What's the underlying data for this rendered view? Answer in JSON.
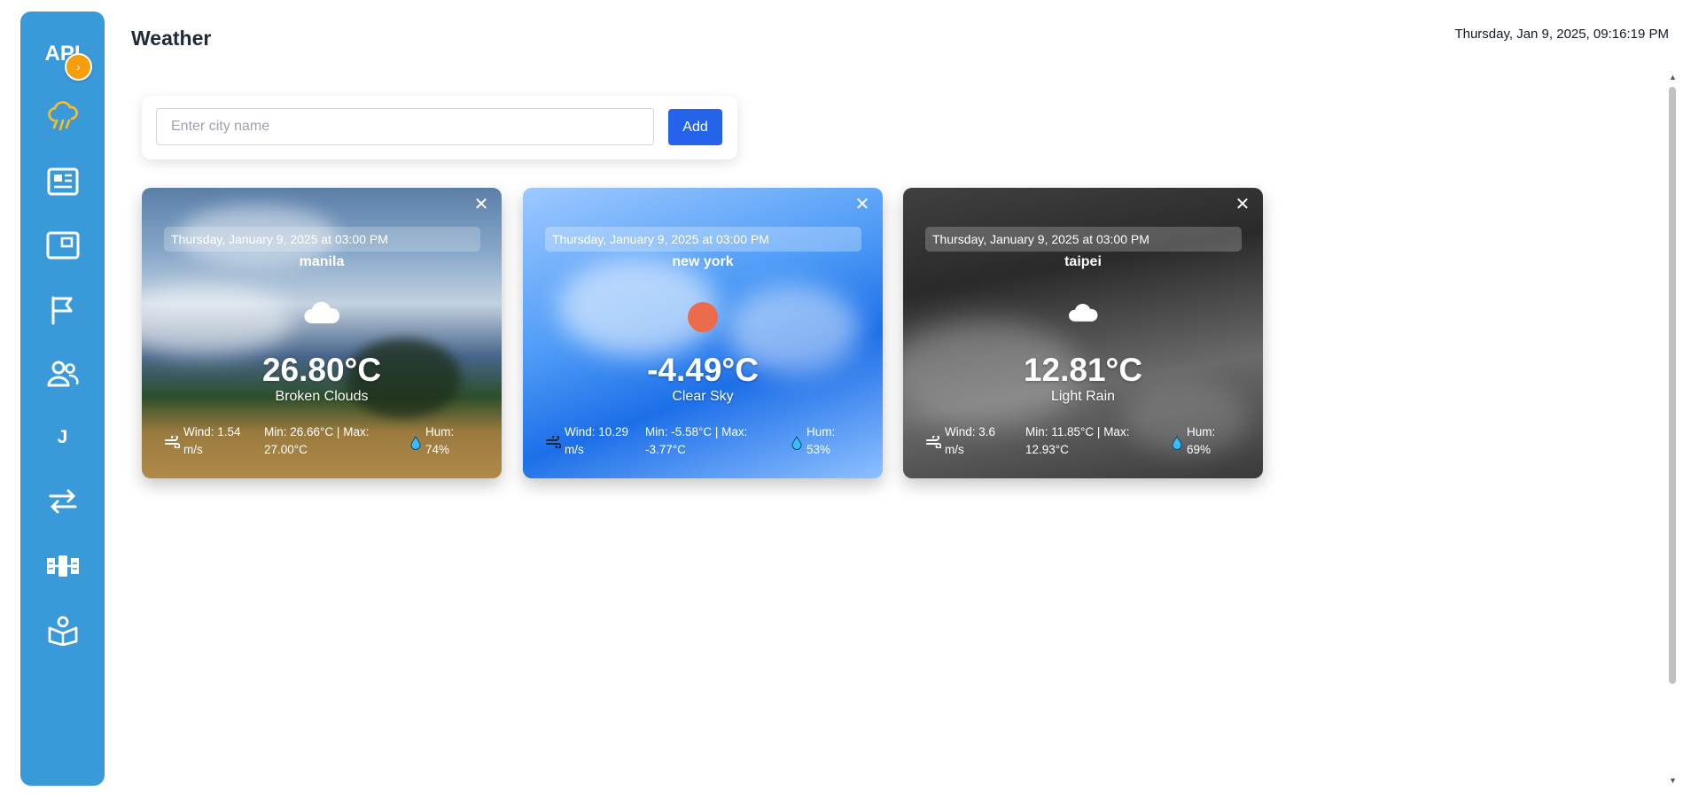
{
  "sidebar": {
    "brand": "API",
    "collapse_icon": "chevron-right-icon",
    "items": [
      {
        "name": "weather",
        "icon": "cloud-rain-icon"
      },
      {
        "name": "news",
        "icon": "newspaper-icon"
      },
      {
        "name": "card",
        "icon": "window-icon"
      },
      {
        "name": "flags",
        "icon": "flag-icon"
      },
      {
        "name": "users",
        "icon": "users-icon"
      },
      {
        "name": "jokes",
        "icon": "letter-j-icon",
        "label": "J"
      },
      {
        "name": "exchange",
        "icon": "exchange-icon"
      },
      {
        "name": "satellite",
        "icon": "satellite-icon"
      },
      {
        "name": "book",
        "icon": "book-reader-icon"
      }
    ]
  },
  "header": {
    "title": "Weather",
    "datetime": "Thursday, Jan 9, 2025, 09:16:19 PM"
  },
  "search": {
    "placeholder": "Enter city name",
    "value": "",
    "add_label": "Add"
  },
  "cards": [
    {
      "date": "Thursday, January 9, 2025 at 03:00 PM",
      "city": "manila",
      "icon": "cloud-icon",
      "temp": "26.80°C",
      "description": "Broken Clouds",
      "wind": "Wind: 1.54 m/s",
      "minmax": "Min: 26.66°C | Max: 27.00°C",
      "humidity": "Hum: 74%"
    },
    {
      "date": "Thursday, January 9, 2025 at 03:00 PM",
      "city": "new york",
      "icon": "sun-icon",
      "temp": "-4.49°C",
      "description": "Clear Sky",
      "wind": "Wind: 10.29 m/s",
      "minmax": "Min: -5.58°C | Max: -3.77°C",
      "humidity": "Hum: 53%"
    },
    {
      "date": "Thursday, January 9, 2025 at 03:00 PM",
      "city": "taipei",
      "icon": "cloud-icon",
      "temp": "12.81°C",
      "description": "Light Rain",
      "wind": "Wind: 3.6 m/s",
      "minmax": "Min: 11.85°C | Max: 12.93°C",
      "humidity": "Hum: 69%"
    }
  ],
  "colors": {
    "sidebar": "#3a9ad9",
    "accent": "#f59e0b",
    "add_button": "#2563eb",
    "sun": "#ec6b4b"
  }
}
